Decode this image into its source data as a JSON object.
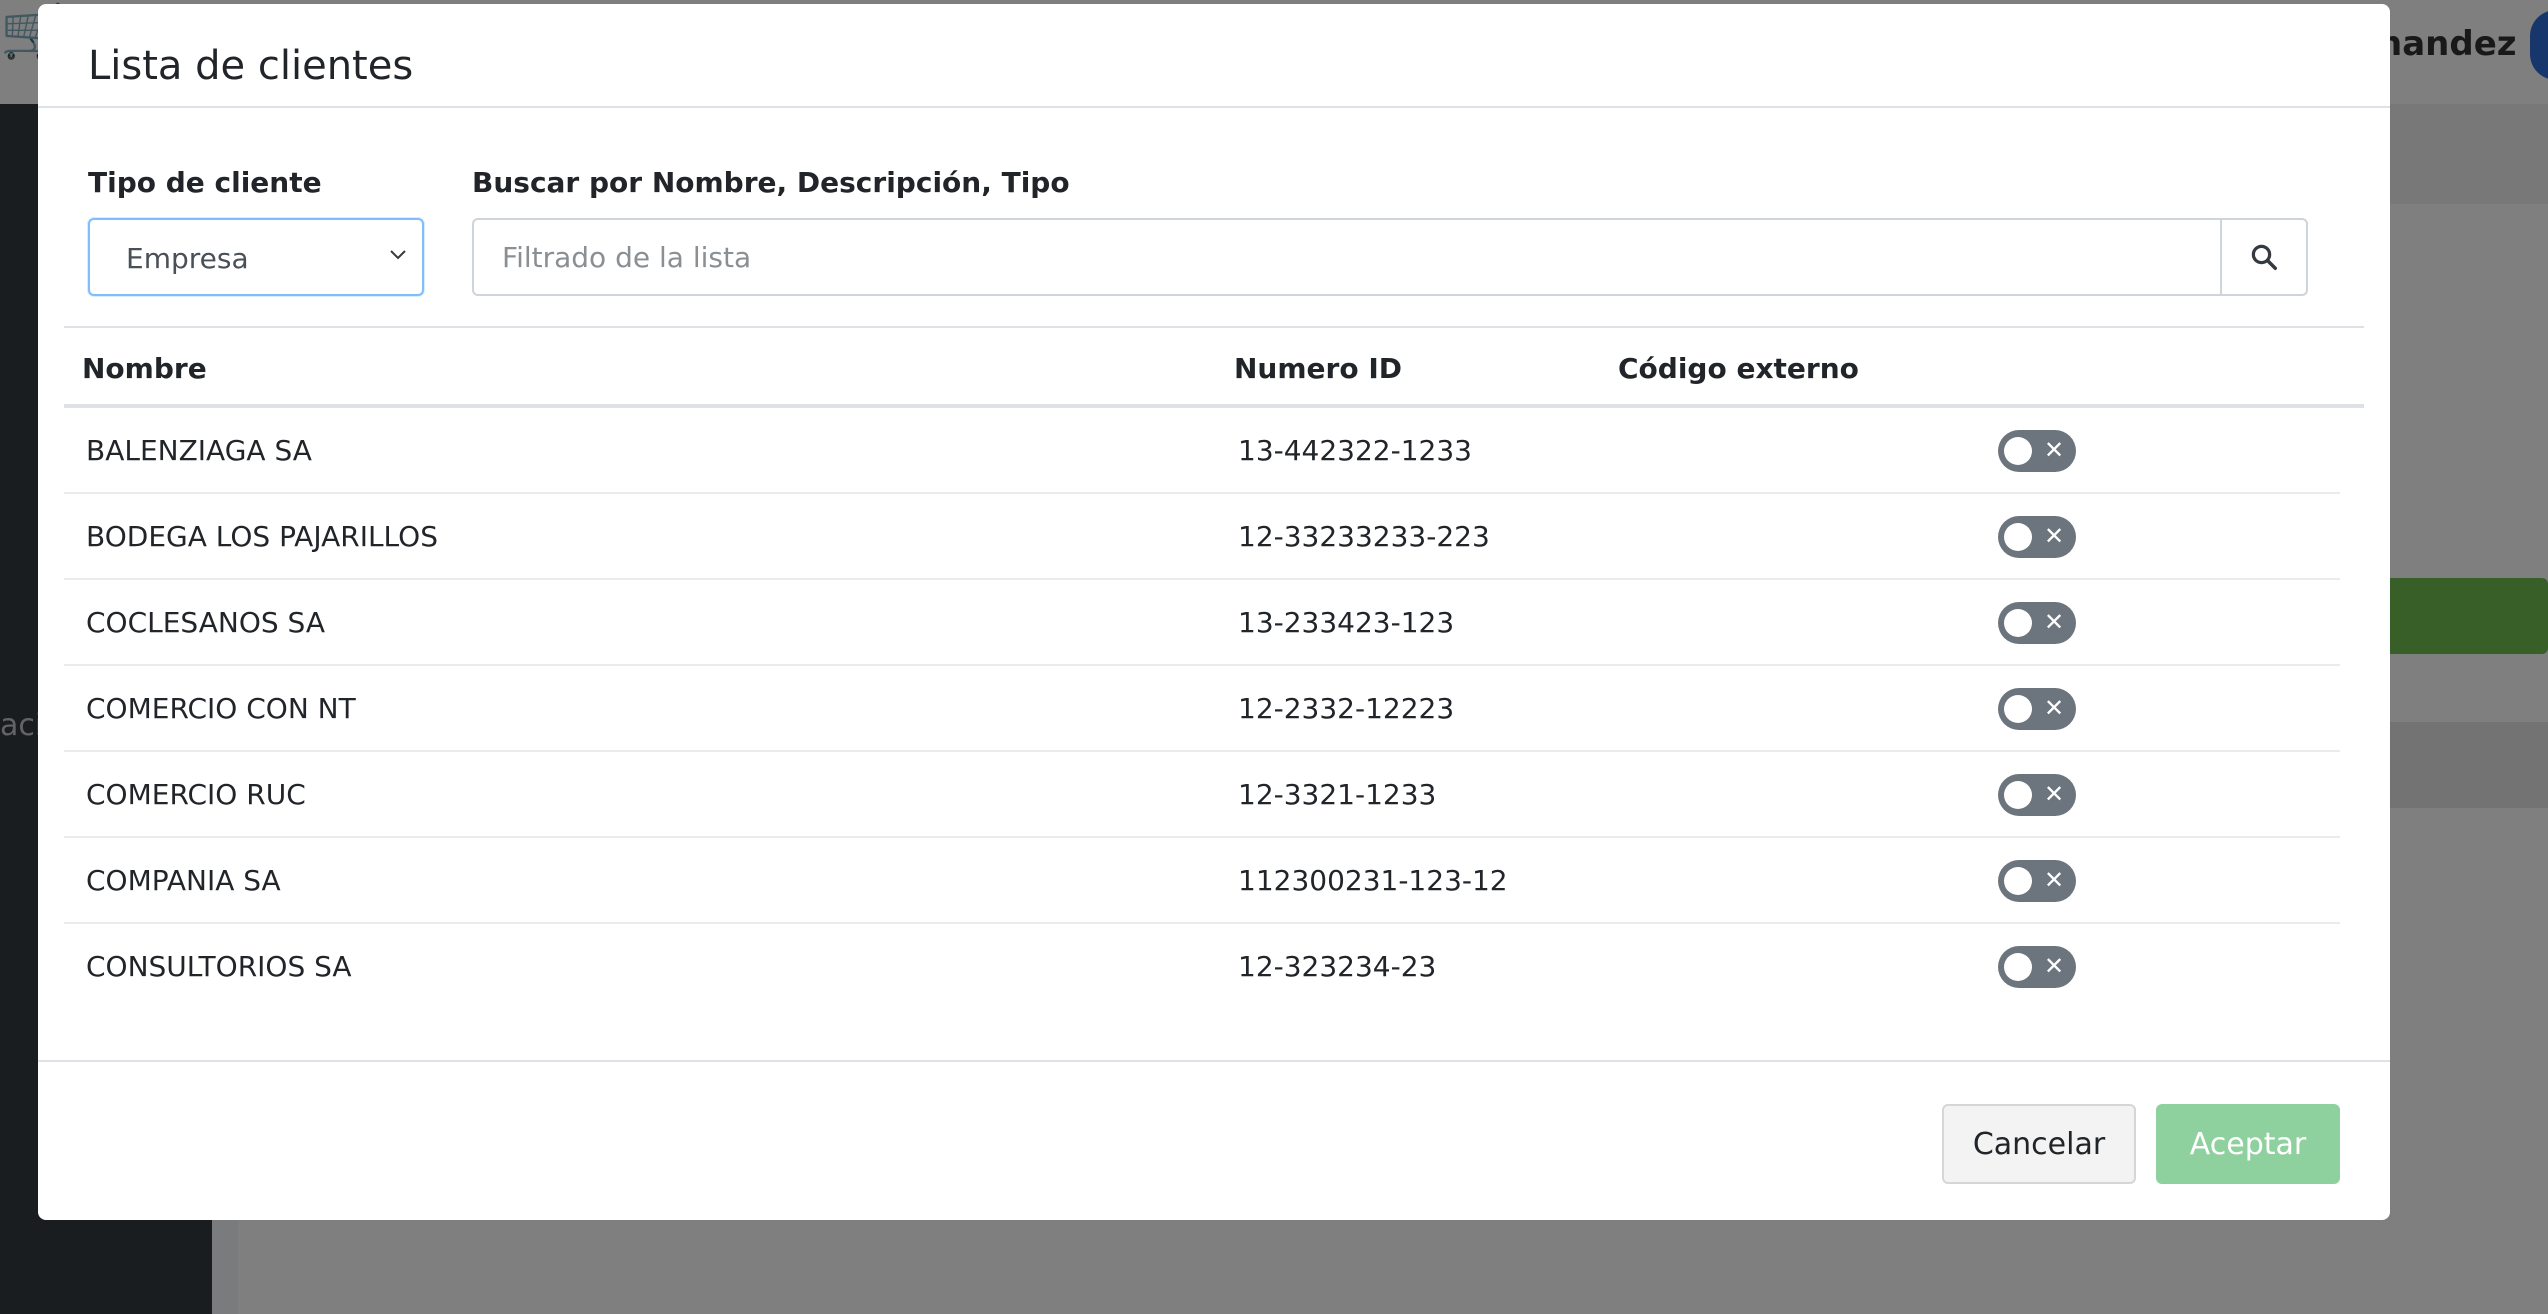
{
  "background": {
    "username": "nandez",
    "sidebar_text": "aci"
  },
  "modal": {
    "title": "Lista de clientes",
    "filters": {
      "client_type_label": "Tipo de cliente",
      "client_type_value": "Empresa",
      "search_label": "Buscar por Nombre, Descripción, Tipo",
      "search_placeholder": "Filtrado de la lista",
      "search_value": ""
    },
    "table": {
      "columns": [
        "Nombre",
        "Numero ID",
        "Código externo"
      ],
      "rows": [
        {
          "name": "BALENZIAGA SA",
          "id": "13-442322-1233",
          "external_code": "",
          "toggle": "off"
        },
        {
          "name": "BODEGA LOS PAJARILLOS",
          "id": "12-33233233-223",
          "external_code": "",
          "toggle": "off"
        },
        {
          "name": "COCLESANOS SA",
          "id": "13-233423-123",
          "external_code": "",
          "toggle": "off"
        },
        {
          "name": "COMERCIO CON NT",
          "id": "12-2332-12223",
          "external_code": "",
          "toggle": "off"
        },
        {
          "name": "COMERCIO RUC",
          "id": "12-3321-1233",
          "external_code": "",
          "toggle": "off"
        },
        {
          "name": "COMPANIA SA",
          "id": "112300231-123-12",
          "external_code": "",
          "toggle": "off"
        },
        {
          "name": "CONSULTORIOS SA",
          "id": "12-323234-23",
          "external_code": "",
          "toggle": "off"
        }
      ]
    },
    "footer": {
      "cancel_label": "Cancelar",
      "accept_label": "Aceptar"
    }
  },
  "colors": {
    "toggle_off": "#6c757d",
    "accept_disabled": "#8fd19e",
    "focus_border": "#80bdff"
  }
}
